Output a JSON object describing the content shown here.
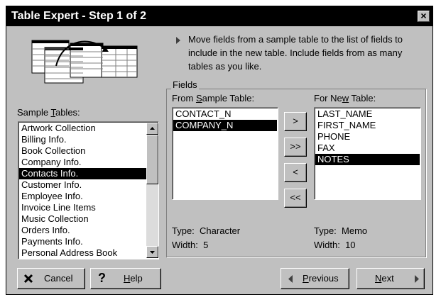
{
  "window": {
    "title": "Table Expert - Step 1 of 2",
    "close_label": "×"
  },
  "instruction": {
    "text": "Move fields from a sample table to the list of fields to include in the new table.  Include fields from as many tables as you like."
  },
  "sample_tables": {
    "label_pre": "Sample ",
    "label_underline": "T",
    "label_post": "ables:",
    "items": [
      "Artwork Collection",
      "Billing Info.",
      "Book Collection",
      "Company Info.",
      "Contacts Info.",
      "Customer Info.",
      "Employee Info.",
      "Invoice Line Items",
      "Music Collection",
      "Orders Info.",
      "Payments Info.",
      "Personal Address Book"
    ],
    "selected_index": 4
  },
  "fields_group": {
    "legend": "Fields"
  },
  "from_sample": {
    "label_pre": "From ",
    "label_underline": "S",
    "label_post": "ample Table:",
    "items": [
      "CONTACT_N",
      "COMPANY_N"
    ],
    "selected_index": 1,
    "type_label": "Type:",
    "type_value": "Character",
    "width_label": "Width:",
    "width_value": "5"
  },
  "for_new": {
    "label_pre": "For Ne",
    "label_underline": "w",
    "label_post": " Table:",
    "items": [
      "LAST_NAME",
      "FIRST_NAME",
      "PHONE",
      "FAX",
      "NOTES"
    ],
    "selected_index": 4,
    "type_label": "Type:",
    "type_value": "Memo",
    "width_label": "Width:",
    "width_value": "10"
  },
  "move_buttons": {
    "add": ">",
    "add_all": ">>",
    "remove": "<",
    "remove_all": "<<"
  },
  "footer": {
    "cancel": "Cancel",
    "help_pre": "",
    "help_underline": "H",
    "help_post": "elp",
    "previous_pre": "",
    "previous_underline": "P",
    "previous_post": "revious",
    "next_pre": "",
    "next_underline": "N",
    "next_post": "ext"
  },
  "icons": {
    "cancel": "x-icon",
    "help": "question-icon",
    "previous": "triangle-left-icon",
    "next": "triangle-right-icon",
    "bullet": "triangle-right-icon",
    "illustration": "table-diagram-icon"
  }
}
